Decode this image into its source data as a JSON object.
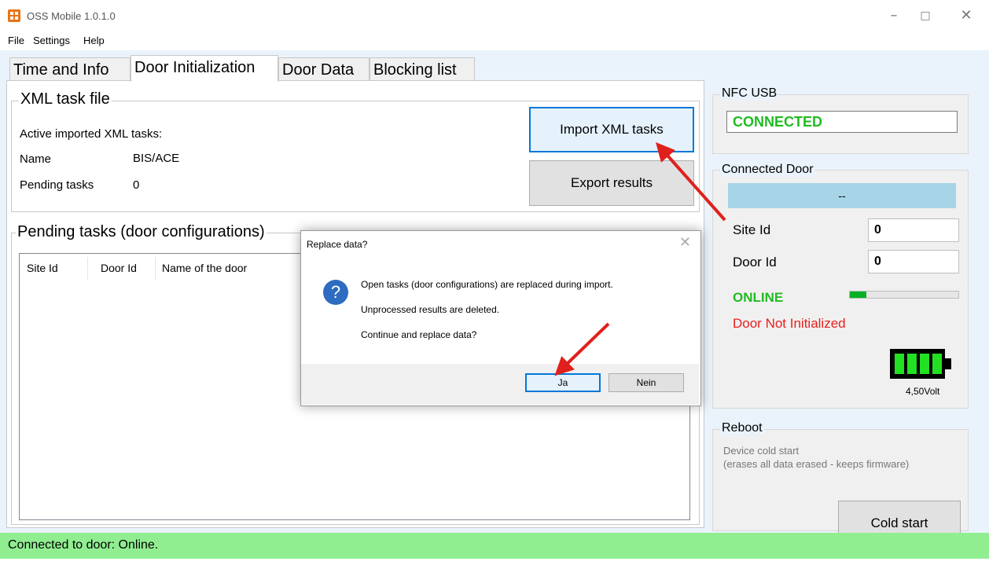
{
  "window": {
    "title": "OSS Mobile 1.0.1.0",
    "minimize": "–",
    "maximize": "□",
    "close": "✕"
  },
  "menu": [
    "File",
    "Settings",
    "Help"
  ],
  "tabs": [
    "Time and Info",
    "Door Initialization",
    "Door Data",
    "Blocking list"
  ],
  "active_tab": "Door Initialization",
  "xml_group": {
    "title": "XML task file",
    "active_label": "Active imported XML tasks:",
    "name_label": "Name",
    "name_value": "BIS/ACE",
    "pending_label": "Pending tasks",
    "pending_value": "0",
    "import_button": "Import XML tasks",
    "export_button": "Export results"
  },
  "pending_group": {
    "title": "Pending tasks (door configurations)",
    "columns": [
      "Site Id",
      "Door Id",
      "Name of the door"
    ]
  },
  "nfc": {
    "title": "NFC USB",
    "status": "CONNECTED"
  },
  "door": {
    "title": "Connected Door",
    "door_name": "--",
    "site_label": "Site Id",
    "site_value": "0",
    "door_label": "Door Id",
    "door_value": "0",
    "online": "ONLINE",
    "signal_level": 0.15,
    "init_status": "Door Not Initialized",
    "voltage": "4,50Volt"
  },
  "reboot": {
    "title": "Reboot",
    "line1": "Device cold start",
    "line2": "(erases all data erased - keeps firmware)",
    "button": "Cold start"
  },
  "dialog": {
    "title": "Replace data?",
    "close": "✕",
    "icon": "?",
    "line1": "Open tasks (door configurations) are replaced during import.",
    "line2": "Unprocessed results are deleted.",
    "line3": "Continue and replace data?",
    "yes": "Ja",
    "no": "Nein"
  },
  "statusbar": "Connected to door: Online.",
  "colors": {
    "online": "#22bb22",
    "warning": "#e8201e",
    "status_bg": "#90ee90",
    "door_bar": "#a7d4e6",
    "arrow": "#e0201c"
  }
}
